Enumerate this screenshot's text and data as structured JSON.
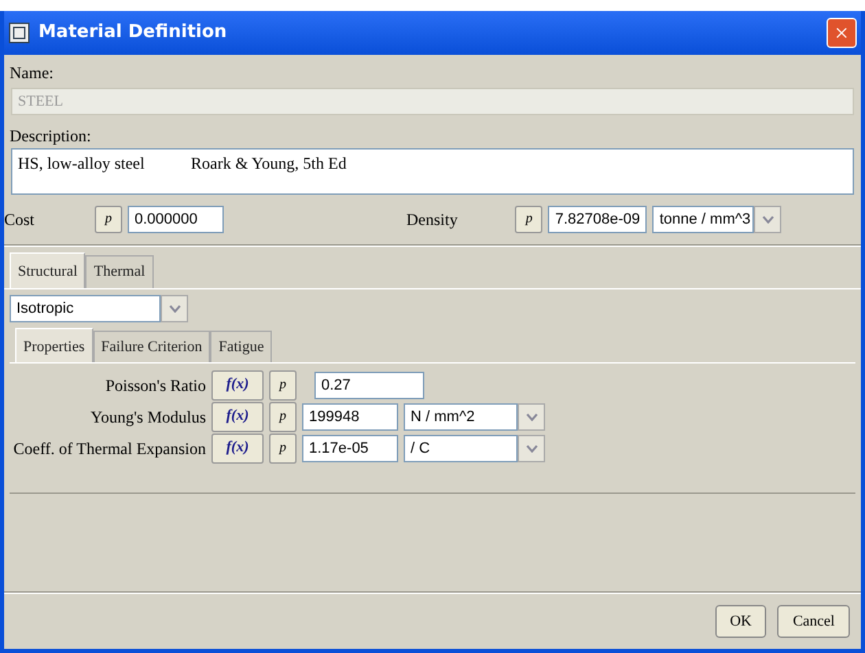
{
  "window": {
    "title": "Material Definition",
    "close": "×"
  },
  "name": {
    "label": "Name:",
    "value": "STEEL",
    "disabled": true
  },
  "description": {
    "label": "Description:",
    "value": "HS, low-alloy steel\tRoark & Young, 5th Ed"
  },
  "cost": {
    "label": "Cost",
    "p_button": "p",
    "value": "0.000000"
  },
  "density": {
    "label": "Density",
    "p_button": "p",
    "value": "7.82708e-09",
    "unit": "tonne / mm^3"
  },
  "tabs": [
    {
      "label": "Structural",
      "selected": true
    },
    {
      "label": "Thermal",
      "selected": false
    }
  ],
  "material_type": "Isotropic",
  "subtabs": [
    {
      "label": "Properties",
      "selected": true
    },
    {
      "label": "Failure Criterion",
      "selected": false
    },
    {
      "label": "Fatigue",
      "selected": false
    }
  ],
  "properties": [
    {
      "label": "Poisson's Ratio",
      "fx_button": "f(x)",
      "p_button": "p",
      "value": "0.27"
    },
    {
      "label": "Young's Modulus",
      "fx_button": "f(x)",
      "p_button": "p",
      "value": "199948",
      "unit": "N / mm^2"
    },
    {
      "label": "Coeff. of Thermal Expansion",
      "fx_button": "f(x)",
      "p_button": "p",
      "value": "1.17e-05",
      "unit": "/ C"
    }
  ],
  "buttons": [
    "OK",
    "Cancel"
  ]
}
